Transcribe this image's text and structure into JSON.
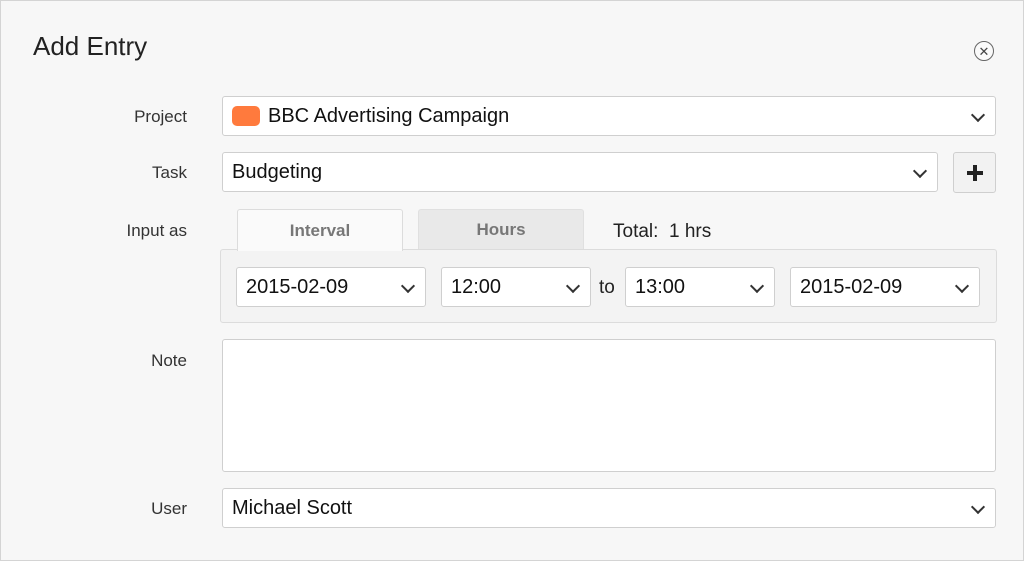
{
  "dialog": {
    "title": "Add Entry",
    "close_icon": "close-circle-icon"
  },
  "form": {
    "project": {
      "label": "Project",
      "value": "BBC Advertising Campaign",
      "color": "#ff7a3d"
    },
    "task": {
      "label": "Task",
      "value": "Budgeting",
      "add_icon": "plus-icon"
    },
    "input_as": {
      "label": "Input as",
      "tabs": [
        {
          "label": "Interval",
          "active": true
        },
        {
          "label": "Hours",
          "active": false
        }
      ],
      "total": "Total:  1 hrs"
    },
    "interval": {
      "start_date": "2015-02-09",
      "start_time": "12:00",
      "separator": "to",
      "end_time": "13:00",
      "end_date": "2015-02-09"
    },
    "note": {
      "label": "Note",
      "value": ""
    },
    "user": {
      "label": "User",
      "value": "Michael Scott"
    }
  }
}
